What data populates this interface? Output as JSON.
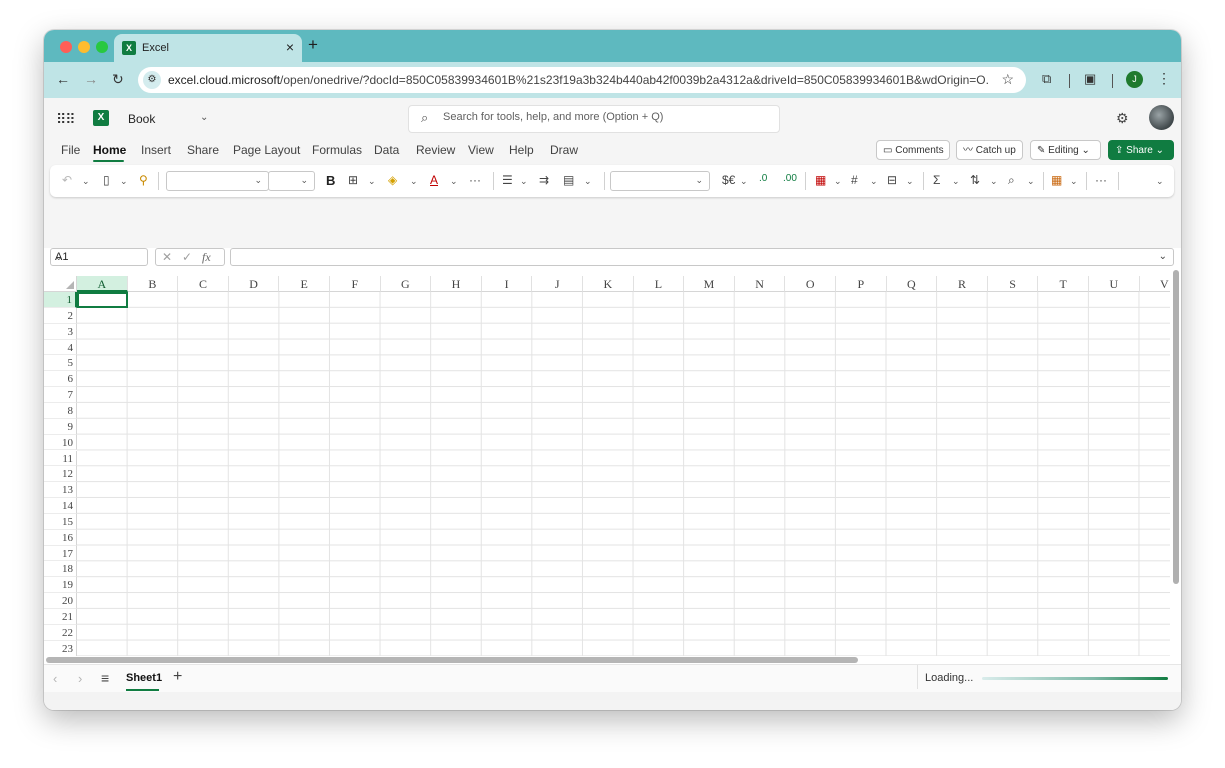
{
  "browser": {
    "tab_title": "Excel",
    "tab_close": "×",
    "new_tab": "+",
    "url_host": "excel.cloud.microsoft",
    "url_path": "/open/onedrive/?docId=850C05839934601B%21s23f19a3b324b440ab42f0039b2a4312a&driveId=850C05839934601B&wdOrigin=O...",
    "profile_initial": "J"
  },
  "app": {
    "logo_letter": "X",
    "document_name": "Book",
    "search_placeholder": "Search for tools, help, and more (Option + Q)"
  },
  "ribbon": {
    "tabs": [
      "File",
      "Home",
      "Insert",
      "Share",
      "Page Layout",
      "Formulas",
      "Data",
      "Review",
      "View",
      "Help",
      "Draw"
    ],
    "active_tab": "Home",
    "comments_label": "Comments",
    "catchup_label": "Catch up",
    "editing_label": "Editing",
    "share_label": "Share"
  },
  "formula_bar": {
    "name_box": "A1",
    "formula": ""
  },
  "grid": {
    "columns": [
      "A",
      "B",
      "C",
      "D",
      "E",
      "F",
      "G",
      "H",
      "I",
      "J",
      "K",
      "L",
      "M",
      "N",
      "O",
      "P",
      "Q",
      "R",
      "S",
      "T",
      "U",
      "V"
    ],
    "rows": [
      "1",
      "2",
      "3",
      "4",
      "5",
      "6",
      "7",
      "8",
      "9",
      "10",
      "11",
      "12",
      "13",
      "14",
      "15",
      "16",
      "17",
      "18",
      "19",
      "20",
      "21",
      "22",
      "23"
    ],
    "active_cell": "A1"
  },
  "sheets": {
    "tabs": [
      "Sheet1"
    ],
    "active": "Sheet1",
    "status": "Loading..."
  },
  "colors": {
    "excel_green": "#107c41",
    "browser_teal": "#5eb9bf"
  }
}
